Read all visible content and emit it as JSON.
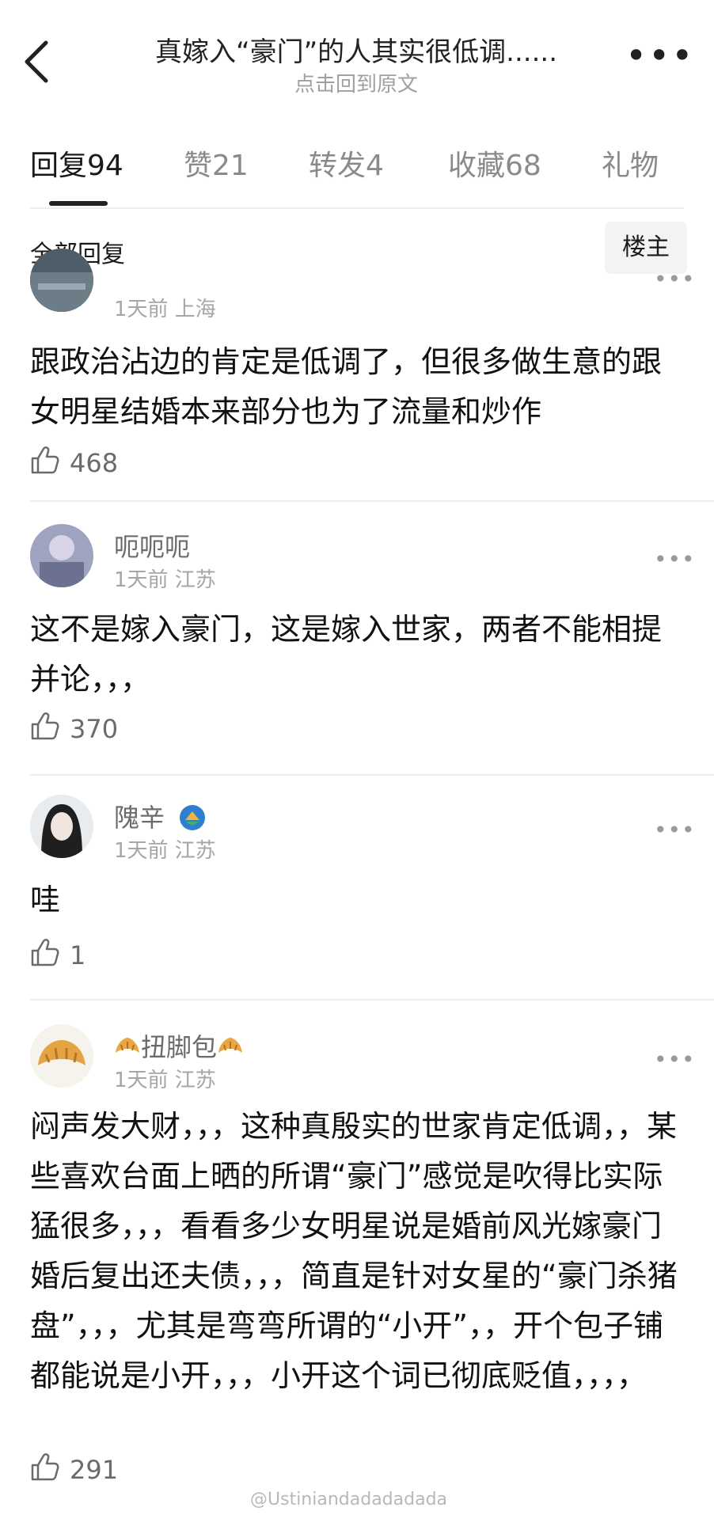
{
  "header": {
    "title": "真嫁入“豪门”的人其实很低调......",
    "subtitle": "点击回到原文",
    "more": "•••"
  },
  "tabs": [
    {
      "label": "回复",
      "count": "94"
    },
    {
      "label": "赞",
      "count": "21"
    },
    {
      "label": "转发",
      "count": "4"
    },
    {
      "label": "收藏",
      "count": "68"
    },
    {
      "label": "礼物",
      "count": ""
    }
  ],
  "filter": {
    "label": "全部回复",
    "owner_button": "楼主"
  },
  "comments": [
    {
      "username": "",
      "meta": "1天前 上海",
      "content": "跟政治沾边的肯定是低调了，但很多做生意的跟女明星结婚本来部分也为了流量和炒作",
      "likes": "468",
      "avatar_color": "#51606a"
    },
    {
      "username": "呃呃呃",
      "meta": "1天前 江苏",
      "content": "这不是嫁入豪门，这是嫁入世家，两者不能相提并论，，，",
      "likes": "370",
      "avatar_color": "#8a8fa8"
    },
    {
      "username": "隗辛",
      "meta": "1天前 江苏",
      "content": "哇",
      "likes": "1",
      "avatar_color": "#2b2b2b"
    },
    {
      "username": "扭脚包",
      "meta": "1天前 江苏",
      "content": "闷声发大财，，，这种真殷实的世家肯定低调，，某些喜欢台面上晒的所谓“豪门”感觉是吹得比实际猛很多，，，看看多少女明星说是婚前风光嫁豪门婚后复出还夫债，，，简直是针对女星的“豪门杀猪盘”，，，尤其是弯弯所谓的“小开”，，开个包子铺都能说是小开，，，小开这个词已彻底贬值，，，，",
      "likes": "291",
      "avatar_color": "#f4f0ea"
    }
  ],
  "watermark": "@Ustiniandadadadada"
}
